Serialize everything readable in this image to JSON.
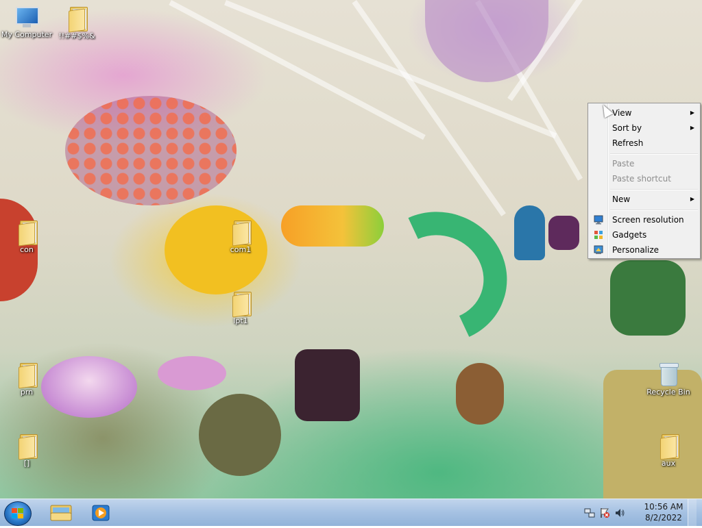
{
  "desktop": {
    "icons": [
      {
        "label": "My Computer",
        "type": "computer"
      },
      {
        "label": "!!##$%&",
        "type": "folder"
      },
      {
        "label": "con",
        "type": "folder"
      },
      {
        "label": "com1",
        "type": "folder"
      },
      {
        "label": "lpt1",
        "type": "folder"
      },
      {
        "label": "prn",
        "type": "folder"
      },
      {
        "label": "[]",
        "type": "folder"
      },
      {
        "label": "Recycle Bin",
        "type": "recycle-bin"
      },
      {
        "label": "aux",
        "type": "folder"
      }
    ]
  },
  "context_menu": {
    "items": [
      {
        "label": "View",
        "submenu": true,
        "enabled": true,
        "icon": ""
      },
      {
        "label": "Sort by",
        "submenu": true,
        "enabled": true,
        "icon": ""
      },
      {
        "label": "Refresh",
        "submenu": false,
        "enabled": true,
        "icon": ""
      },
      {
        "label": "Paste",
        "submenu": false,
        "enabled": false,
        "icon": ""
      },
      {
        "label": "Paste shortcut",
        "submenu": false,
        "enabled": false,
        "icon": ""
      },
      {
        "label": "New",
        "submenu": true,
        "enabled": true,
        "icon": ""
      },
      {
        "label": "Screen resolution",
        "submenu": false,
        "enabled": true,
        "icon": "display-icon"
      },
      {
        "label": "Gadgets",
        "submenu": false,
        "enabled": true,
        "icon": "gadgets-icon"
      },
      {
        "label": "Personalize",
        "submenu": false,
        "enabled": true,
        "icon": "personalize-icon"
      }
    ]
  },
  "taskbar": {
    "start_icon": "windows-logo-icon",
    "pinned": [
      {
        "name": "windows-explorer",
        "icon": "folder-library-icon"
      },
      {
        "name": "windows-media-player",
        "icon": "media-player-icon"
      }
    ],
    "tray_icons": [
      "network-icon",
      "action-center-flag-icon",
      "volume-icon"
    ],
    "clock": {
      "time": "10:56 AM",
      "date": "8/2/2022"
    }
  },
  "colors": {
    "menu_bg": "#f0f0f0",
    "menu_border": "#979797",
    "disabled_text": "#8d8d8d",
    "taskbar": "#a7c2e1"
  }
}
